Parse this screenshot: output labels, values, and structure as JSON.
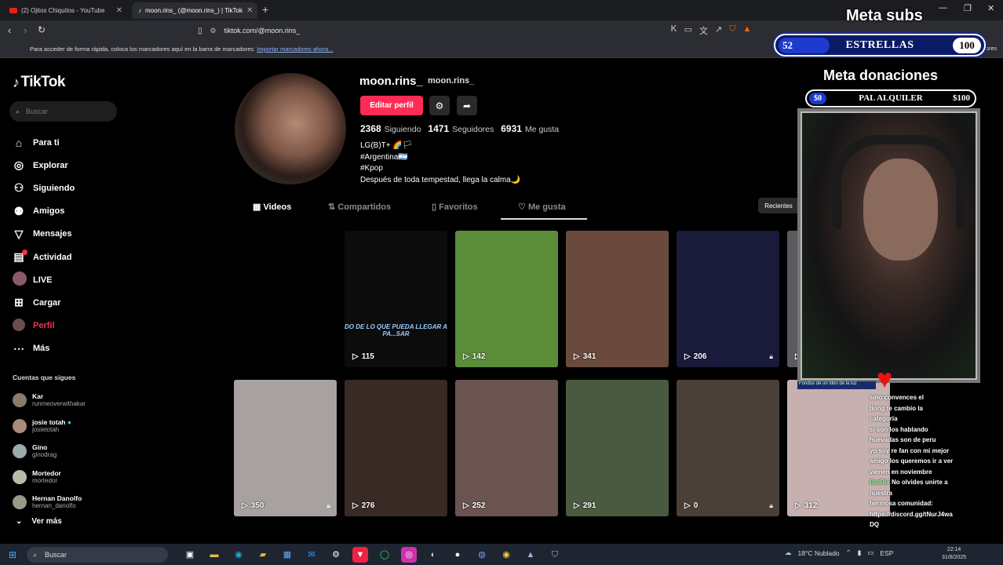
{
  "browser": {
    "tabs": [
      {
        "title": "(2) Ojitos Chiquitos - YouTube"
      },
      {
        "title": "moon.rins_ (@moon.rins_) | TikTok"
      }
    ],
    "url": "tiktok.com/@moon.rins_",
    "bookmarks_hint": "Para acceder de forma rápida, coloca los marcadores aquí en la barra de marcadores",
    "bookmarks_link": "Importar marcadores ahora...",
    "all_bookmarks": "Todos los marcadores"
  },
  "tiktok": {
    "logo": "TikTok",
    "search_placeholder": "Buscar",
    "nav": [
      {
        "label": "Para ti",
        "icon": "home-icon"
      },
      {
        "label": "Explorar",
        "icon": "compass-icon"
      },
      {
        "label": "Siguiendo",
        "icon": "following-icon"
      },
      {
        "label": "Amigos",
        "icon": "friends-icon"
      },
      {
        "label": "Mensajes",
        "icon": "send-icon"
      },
      {
        "label": "Actividad",
        "icon": "activity-icon",
        "badge": "3"
      },
      {
        "label": "LIVE",
        "icon": "live-icon"
      },
      {
        "label": "Cargar",
        "icon": "upload-icon"
      },
      {
        "label": "Perfil",
        "icon": "profile-icon"
      },
      {
        "label": "Más",
        "icon": "more-icon"
      }
    ],
    "following_header": "Cuentas que sigues",
    "following": [
      {
        "name": "Kar",
        "handle": "runmeoverwithakar"
      },
      {
        "name": "josie totah",
        "handle": "josietotah"
      },
      {
        "name": "Gino",
        "handle": "ginodrag"
      },
      {
        "name": "Mortedor",
        "handle": "mortedor"
      },
      {
        "name": "Hernan Danolfo",
        "handle": "hernan_danolfo"
      }
    ],
    "see_more": "Ver más"
  },
  "profile": {
    "username": "moon.rins_",
    "nickname": "moon.rins_",
    "edit_label": "Editar perfil",
    "stats": {
      "following": "2368",
      "following_label": "Siguiendo",
      "followers": "1471",
      "followers_label": "Seguidores",
      "likes": "6931",
      "likes_label": "Me gusta"
    },
    "bio": [
      "LG(B)T+ 🌈🏳",
      "#Argentina🇦🇷",
      "#Kpop",
      "Después de toda tempestad, llega la calma🌙"
    ],
    "tabs": [
      "Videos",
      "Compartidos",
      "Favoritos",
      "Me gusta"
    ],
    "recientes": "Recientes",
    "videos": [
      {
        "views": "115",
        "caption": "DO DE LO QUE PUEDA LLEGAR A PA...SAR",
        "bg": "#0c0c0c"
      },
      {
        "views": "142",
        "bg": "#5b8c3a"
      },
      {
        "views": "341",
        "bg": "#6a4a3c"
      },
      {
        "views": "206",
        "bg": "#1a1b3a",
        "lock": true
      },
      {
        "views": "272",
        "bg": "#5a5a60",
        "lock": true
      },
      {
        "views": "350",
        "bg": "#a7a2a0",
        "lock": true
      },
      {
        "views": "276",
        "bg": "#3a2a26"
      },
      {
        "views": "252",
        "bg": "#6a5450"
      },
      {
        "views": "291",
        "bg": "#4a5a40"
      },
      {
        "views": "0",
        "bg": "#4a4038",
        "lock": true
      },
      {
        "views": "312",
        "bg": "#c6b0b0"
      }
    ]
  },
  "stream": {
    "meta_subs_title": "Meta subs",
    "subs_current": "52",
    "subs_label": "ESTRELLAS",
    "subs_goal": "100",
    "subs_fraction": 0.52,
    "meta_donations_title": "Meta donaciones",
    "don_current": "$0",
    "don_label": "PAL ALQUILER",
    "don_goal": "$100",
    "cam_label": "Fondos de un lobo de la luz",
    "chat": [
      {
        "user": "",
        "text": "sino convences el"
      },
      {
        "user": "",
        "text": "tlong te cambio la"
      },
      {
        "user": "",
        "text": "categoria"
      },
      {
        "user": "",
        "text": "si son los hablando"
      },
      {
        "user": "",
        "text": "huevadas son de peru"
      },
      {
        "user": "",
        "text": "yo soy re fan con mi mejor"
      },
      {
        "user": "",
        "text": "amigo los queremos ir a ver"
      },
      {
        "user": "",
        "text": "vienen en noviembre"
      },
      {
        "user": "BotRix",
        "text": "No olvides unirte a nuestra"
      },
      {
        "user": "",
        "text": "hermosa comunidad:"
      },
      {
        "user": "",
        "text": "https://discord.gg/tNurJ4wa"
      },
      {
        "user": "",
        "text": "DQ"
      }
    ]
  },
  "taskbar": {
    "search_label": "Buscar",
    "weather": "18°C Nublado",
    "lang": "ESP",
    "time": "22:14",
    "date": "31/8/2025"
  }
}
